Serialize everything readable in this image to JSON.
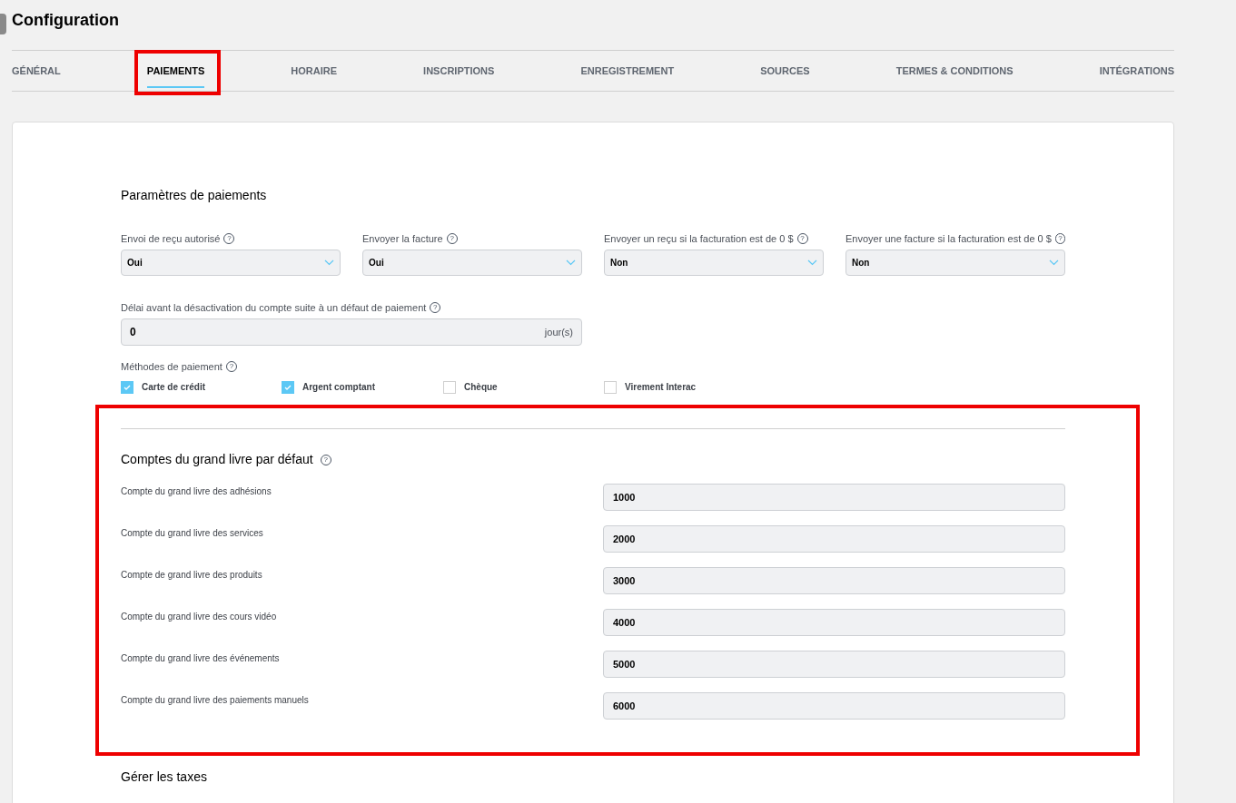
{
  "page": {
    "title": "Configuration"
  },
  "tabs": [
    {
      "label": "GÉNÉRAL",
      "selected": false
    },
    {
      "label": "PAIEMENTS",
      "selected": true
    },
    {
      "label": "HORAIRE",
      "selected": false
    },
    {
      "label": "INSCRIPTIONS",
      "selected": false
    },
    {
      "label": "ENREGISTREMENT",
      "selected": false
    },
    {
      "label": "SOURCES",
      "selected": false
    },
    {
      "label": "TERMES & CONDITIONS",
      "selected": false
    },
    {
      "label": "INTÉGRATIONS",
      "selected": false
    }
  ],
  "payment_settings": {
    "title": "Paramètres de paiements",
    "selects": [
      {
        "label": "Envoi de reçu autorisé",
        "help": "?",
        "value": "Oui"
      },
      {
        "label": "Envoyer la facture",
        "help": "?",
        "value": "Oui"
      },
      {
        "label": "Envoyer un reçu si la facturation est de 0 $",
        "help": "?",
        "value": "Non"
      },
      {
        "label": "Envoyer une facture si la facturation est de 0 $",
        "help": "?",
        "value": "Non"
      }
    ],
    "delay": {
      "label": "Délai avant la désactivation du compte suite à un défaut de paiement",
      "help": "?",
      "value": "0",
      "unit": "jour(s)"
    },
    "methods": {
      "label": "Méthodes de paiement",
      "help": "?",
      "options": [
        {
          "label": "Carte de crédit",
          "checked": true
        },
        {
          "label": "Argent comptant",
          "checked": true
        },
        {
          "label": "Chèque",
          "checked": false
        },
        {
          "label": "Virement Interac",
          "checked": false
        }
      ]
    }
  },
  "ledger": {
    "title": "Comptes du grand livre par défaut",
    "help": "?",
    "rows": [
      {
        "label": "Compte du grand livre des adhésions",
        "value": "1000"
      },
      {
        "label": "Compte du grand livre des services",
        "value": "2000"
      },
      {
        "label": "Compte de grand livre des produits",
        "value": "3000"
      },
      {
        "label": "Compte du grand livre des cours vidéo",
        "value": "4000"
      },
      {
        "label": "Compte du grand livre des événements",
        "value": "5000"
      },
      {
        "label": "Compte du grand livre des paiements manuels",
        "value": "6000"
      }
    ]
  },
  "taxes": {
    "title": "Gérer les taxes"
  }
}
